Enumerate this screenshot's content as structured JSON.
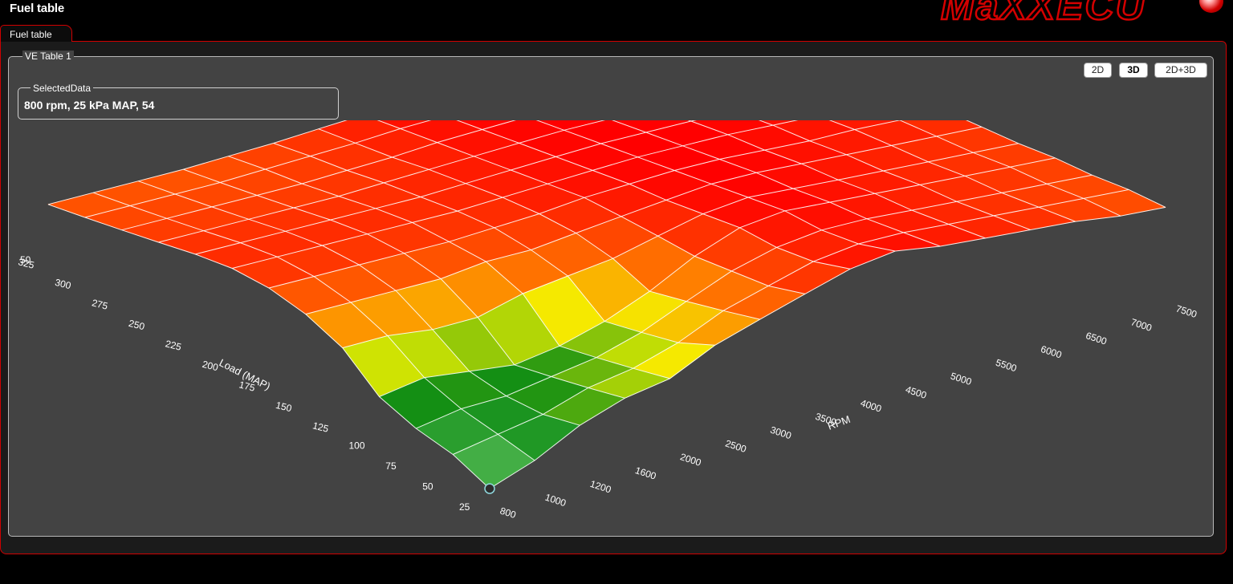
{
  "window": {
    "title": "Fuel table",
    "logo": "MaXXECU"
  },
  "tabs": [
    {
      "label": "Fuel table"
    }
  ],
  "ve_group": {
    "title": "VE Table 1"
  },
  "view_buttons": [
    {
      "label": "2D",
      "active": false
    },
    {
      "label": "3D",
      "active": true
    },
    {
      "label": "2D+3D",
      "active": false
    }
  ],
  "selected_data": {
    "title": "SelectedData",
    "value": "800 rpm, 25 kPa MAP, 54"
  },
  "chart_data": {
    "type": "surface",
    "xlabel": "RPM",
    "ylabel": "Load (MAP)",
    "rpm": [
      800,
      1000,
      1200,
      1600,
      2000,
      2500,
      3000,
      3500,
      4000,
      4500,
      5000,
      5500,
      6000,
      6500,
      7000,
      7500
    ],
    "load": [
      25,
      50,
      75,
      100,
      125,
      150,
      175,
      200,
      225,
      250,
      275,
      300,
      325
    ],
    "z_label": "50",
    "ve": [
      [
        54,
        58,
        64,
        68,
        70,
        76,
        80,
        84,
        88,
        90,
        88,
        87,
        86,
        85,
        83,
        82
      ],
      [
        58,
        60,
        62,
        66,
        68,
        72,
        78,
        82,
        86,
        88,
        88,
        87,
        86,
        85,
        84,
        83
      ],
      [
        60,
        62,
        62,
        64,
        66,
        70,
        76,
        82,
        86,
        88,
        88,
        87,
        86,
        85,
        84,
        83
      ],
      [
        64,
        66,
        64,
        62,
        64,
        68,
        74,
        82,
        88,
        90,
        89,
        88,
        87,
        86,
        85,
        84
      ],
      [
        74,
        74,
        72,
        72,
        76,
        78,
        80,
        84,
        88,
        90,
        89,
        88,
        87,
        86,
        85,
        84
      ],
      [
        80,
        80,
        80,
        80,
        82,
        82,
        84,
        86,
        88,
        90,
        90,
        89,
        88,
        87,
        86,
        85
      ],
      [
        84,
        84,
        84,
        84,
        84,
        85,
        86,
        88,
        89,
        90,
        90,
        89,
        88,
        88,
        87,
        86
      ],
      [
        86,
        86,
        86,
        86,
        86,
        86,
        87,
        88,
        89,
        90,
        90,
        90,
        89,
        88,
        88,
        87
      ],
      [
        86,
        86,
        86,
        86,
        86,
        86,
        87,
        88,
        89,
        90,
        90,
        90,
        89,
        89,
        88,
        88
      ],
      [
        85,
        85,
        85,
        85,
        85,
        86,
        87,
        88,
        89,
        90,
        90,
        90,
        90,
        89,
        88,
        88
      ],
      [
        84,
        84,
        84,
        84,
        84,
        85,
        86,
        88,
        89,
        90,
        90,
        90,
        90,
        89,
        89,
        88
      ],
      [
        83,
        83,
        83,
        83,
        84,
        85,
        86,
        88,
        89,
        90,
        90,
        90,
        90,
        90,
        89,
        88
      ],
      [
        82,
        82,
        82,
        82,
        83,
        84,
        86,
        88,
        89,
        90,
        90,
        90,
        90,
        90,
        89,
        88
      ]
    ],
    "selected": {
      "rpm": 800,
      "load": 25,
      "value": 54
    },
    "color_scale": [
      {
        "at": 0.0,
        "color": "#c8f2f6"
      },
      {
        "at": 0.18,
        "color": "#46b048"
      },
      {
        "at": 0.32,
        "color": "#0e8c14"
      },
      {
        "at": 0.52,
        "color": "#f4f400"
      },
      {
        "at": 0.72,
        "color": "#ff7a00"
      },
      {
        "at": 1.0,
        "color": "#ff0000"
      }
    ]
  }
}
